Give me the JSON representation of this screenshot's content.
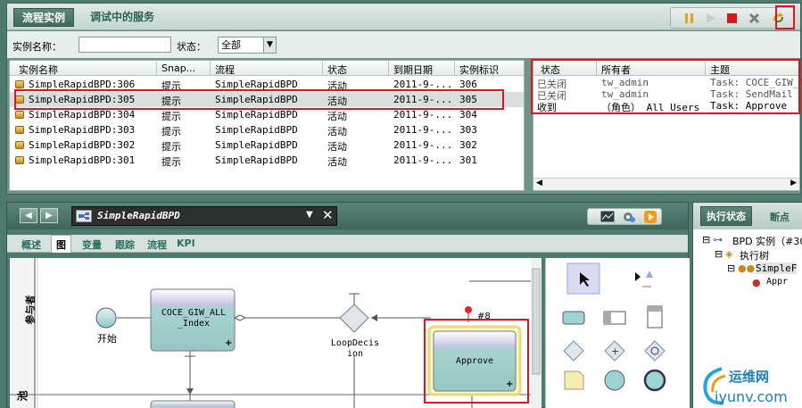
{
  "top_tabs": {
    "instances": "流程实例",
    "debug": "调试中的服务"
  },
  "filter": {
    "name_label": "实例名称：",
    "name_value": "",
    "state_label": "状态：",
    "state_value": "全部"
  },
  "instances": {
    "columns": [
      "实例名称",
      "Snap...",
      "流程",
      "状态",
      "到期日期",
      "实例标识"
    ],
    "rows": [
      {
        "name": "SimpleRapidBPD:306",
        "snap": "提示",
        "process": "SimpleRapidBPD",
        "state": "活动",
        "due": "2011-9-...",
        "id": "306"
      },
      {
        "name": "SimpleRapidBPD:305",
        "snap": "提示",
        "process": "SimpleRapidBPD",
        "state": "活动",
        "due": "2011-9-...",
        "id": "305"
      },
      {
        "name": "SimpleRapidBPD:304",
        "snap": "提示",
        "process": "SimpleRapidBPD",
        "state": "活动",
        "due": "2011-9-...",
        "id": "304"
      },
      {
        "name": "SimpleRapidBPD:303",
        "snap": "提示",
        "process": "SimpleRapidBPD",
        "state": "活动",
        "due": "2011-9-...",
        "id": "303"
      },
      {
        "name": "SimpleRapidBPD:302",
        "snap": "提示",
        "process": "SimpleRapidBPD",
        "state": "活动",
        "due": "2011-9-...",
        "id": "302"
      },
      {
        "name": "SimpleRapidBPD:301",
        "snap": "提示",
        "process": "SimpleRapidBPD",
        "state": "活动",
        "due": "2011-9-...",
        "id": "301"
      }
    ]
  },
  "tasks": {
    "columns": [
      "状态",
      "所有者",
      "主题"
    ],
    "rows": [
      {
        "state": "已关闭",
        "owner": "tw_admin",
        "subject": "Task: COCE_GIW_AL"
      },
      {
        "state": "已关闭",
        "owner": "tw_admin",
        "subject": "Task: SendMail"
      },
      {
        "state": "收到",
        "owner": "（角色） All Users",
        "subject": "Task: Approve"
      }
    ]
  },
  "designer": {
    "tab_title": "SimpleRapidBPD",
    "subtabs": [
      "概述",
      "图",
      "变量",
      "跟踪",
      "流程",
      "KPI"
    ],
    "lane_label": "参与者",
    "lane2_label": "池",
    "start_label": "开始",
    "activity1": "COCE_GIW_ALL _Index",
    "gateway_label": "LoopDecis ion",
    "activity2": "Approve",
    "token_label": "#8"
  },
  "exec": {
    "tab_state": "执行状态",
    "tab_breakpoints": "断点",
    "tree": [
      "BPD 实例（#30",
      "执行树",
      "SimpleF",
      "Appr"
    ]
  },
  "watermark": {
    "text": "运维网",
    "url": "iyunv.com"
  },
  "colors": {
    "highlight": "#e0141e",
    "accent": "#3f6a5e",
    "activity_fill": "#a8d3d0"
  }
}
